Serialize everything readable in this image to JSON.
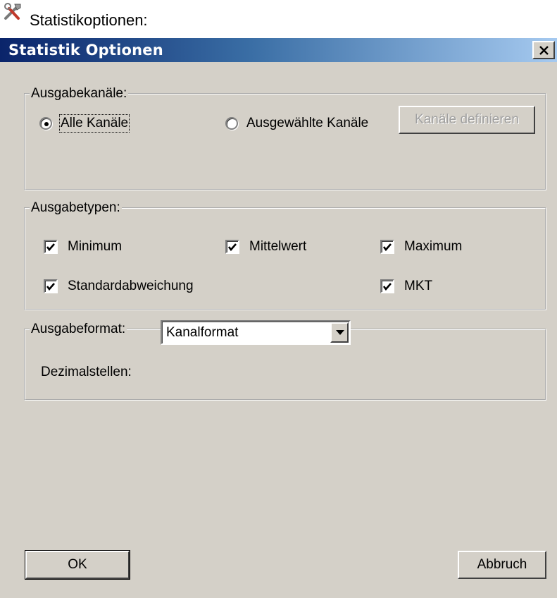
{
  "caption": {
    "text": "Statistikoptionen:",
    "icon": "tools-icon"
  },
  "dialog": {
    "title": "Statistik Optionen",
    "close_icon": "close-icon",
    "colors": {
      "face": "#d4d0c8",
      "title_start": "#0a246a",
      "title_end": "#a6caf0"
    }
  },
  "output_channels": {
    "legend": "Ausgabekanäle:",
    "radio_all": {
      "label": "Alle Kanäle",
      "selected": true
    },
    "radio_selected": {
      "label": "Ausgewählte Kanäle",
      "selected": false
    },
    "define_button": {
      "label": "Kanäle definieren",
      "enabled": false
    }
  },
  "output_types": {
    "legend": "Ausgabetypen:",
    "items": [
      {
        "label": "Minimum",
        "checked": true
      },
      {
        "label": "Mittelwert",
        "checked": true
      },
      {
        "label": "Maximum",
        "checked": true
      },
      {
        "label": "Standardabweichung",
        "checked": true
      },
      {
        "label": "MKT",
        "checked": true
      }
    ]
  },
  "output_format": {
    "legend": "Ausgabeformat:",
    "decimals_label": "Dezimalstellen:",
    "decimals_value": "Kanalformat"
  },
  "footer": {
    "ok_label": "OK",
    "cancel_label": "Abbruch"
  }
}
